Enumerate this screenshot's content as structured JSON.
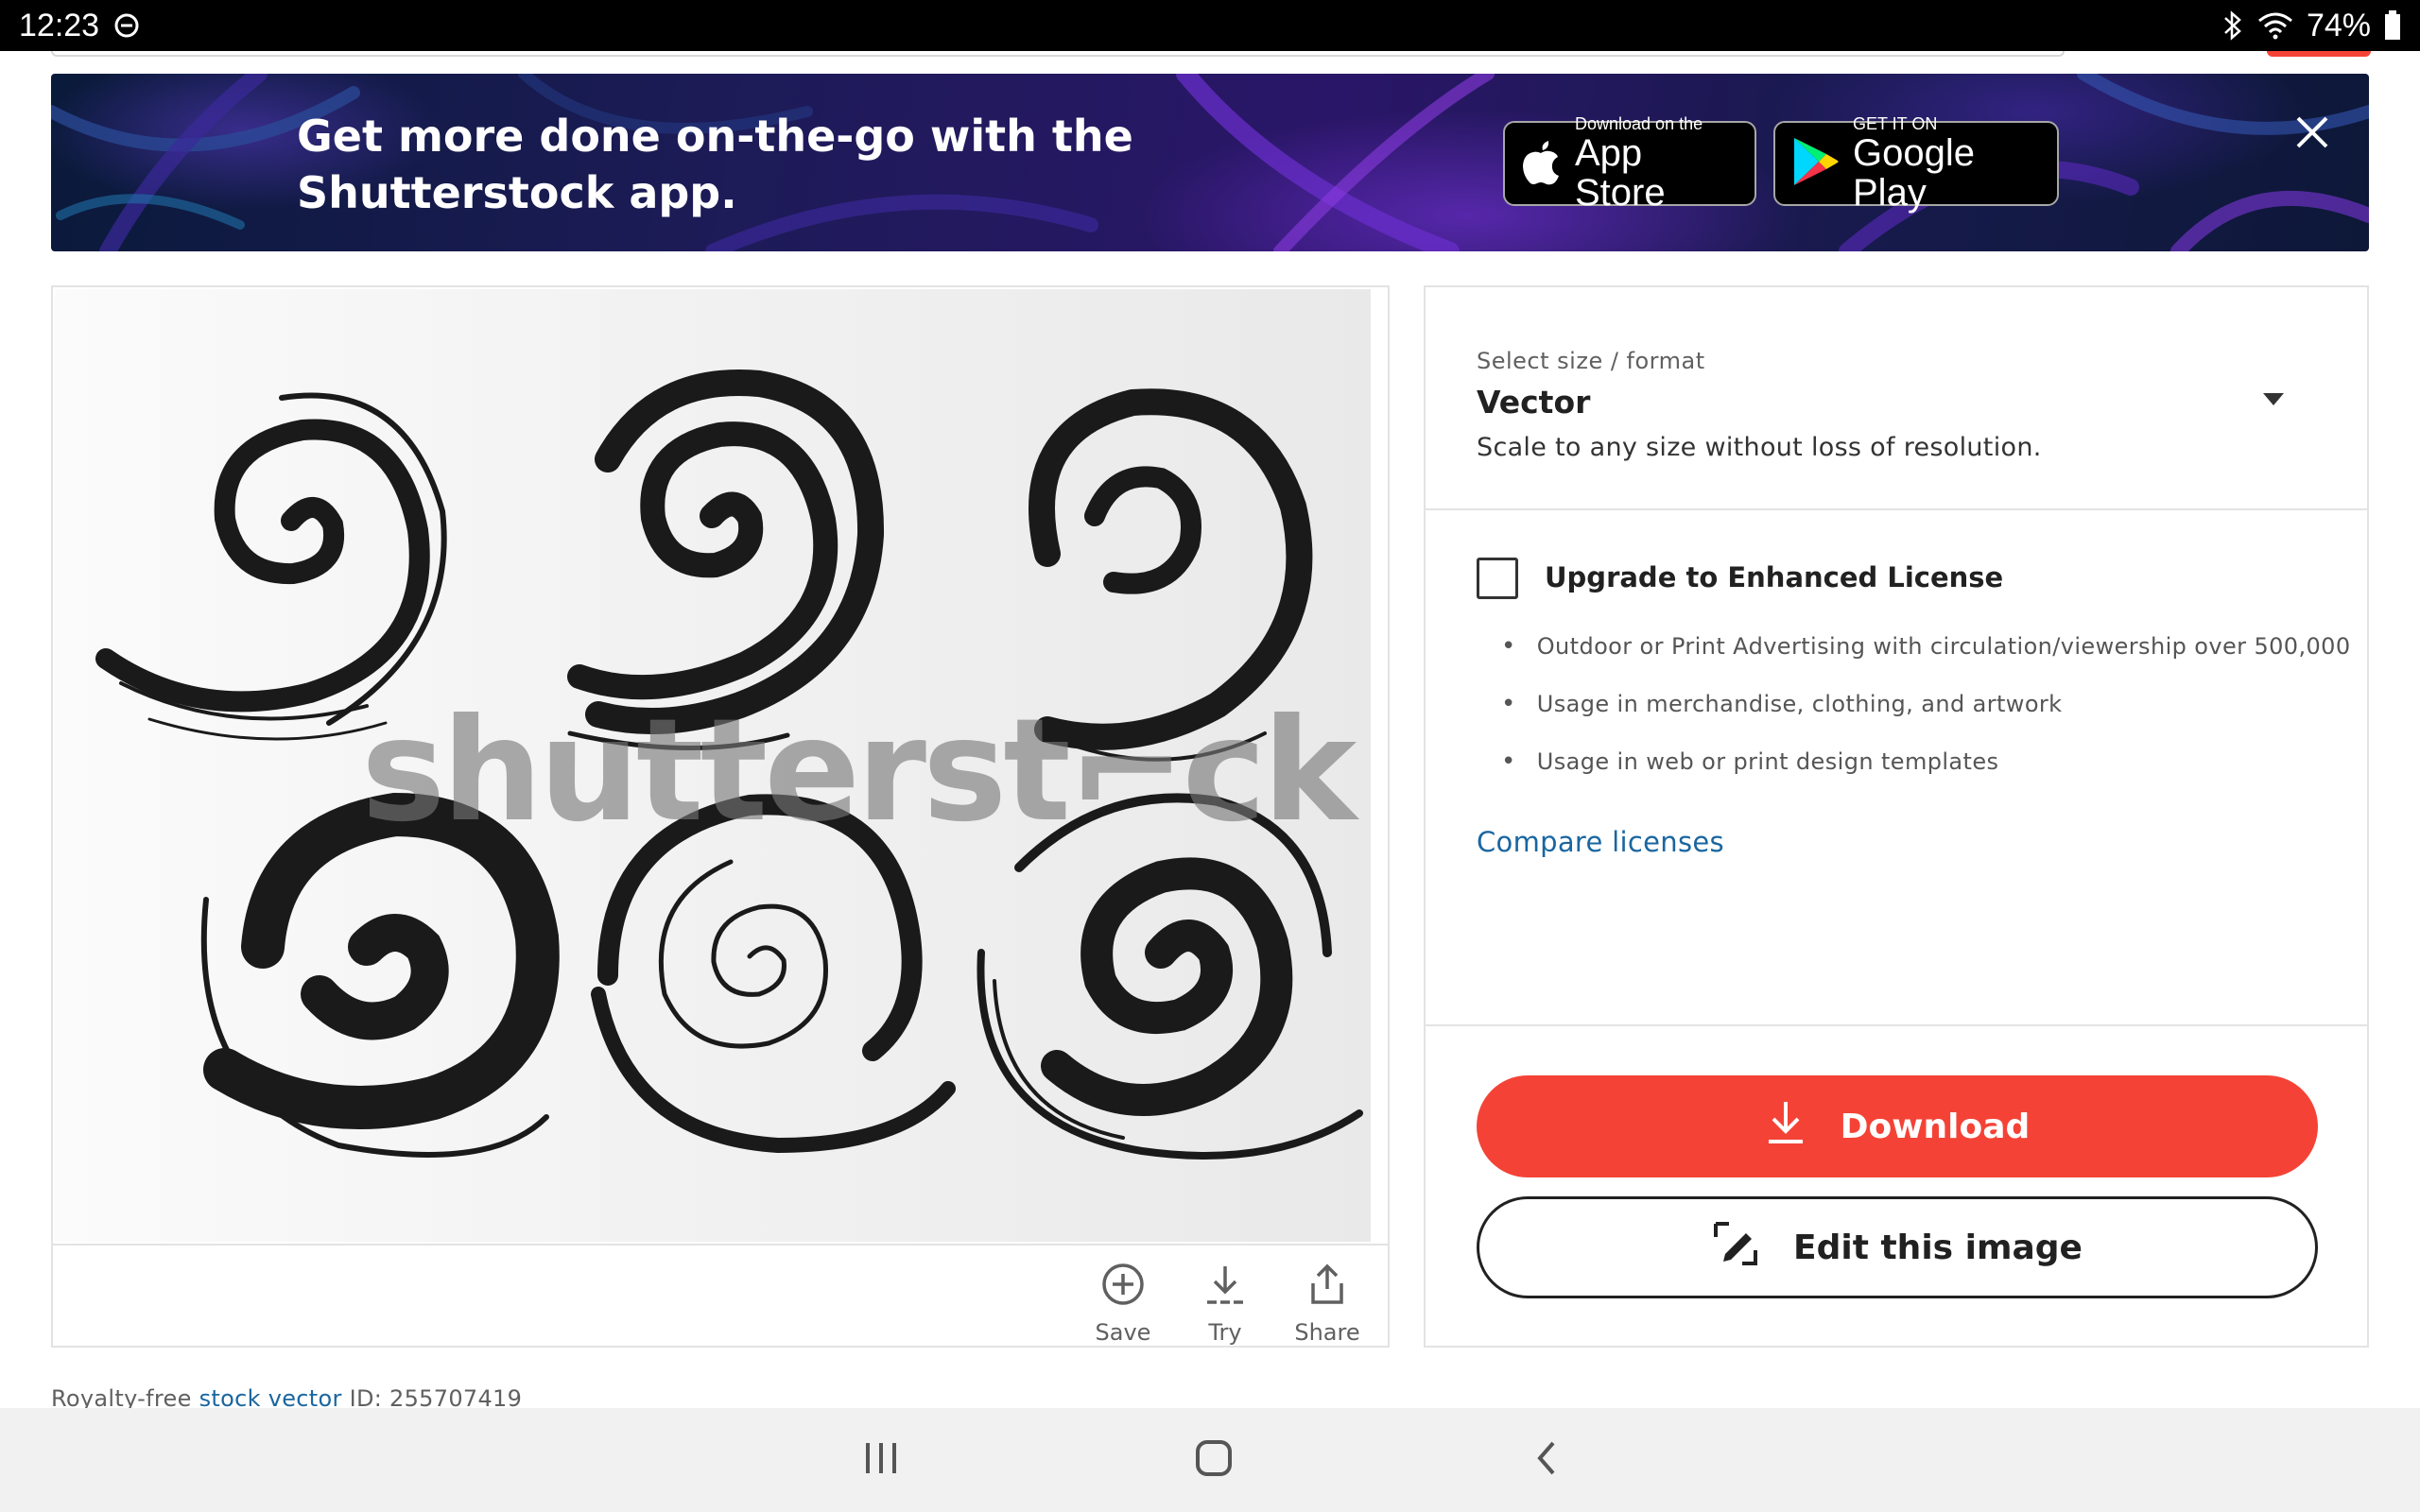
{
  "status_bar": {
    "time": "12:23",
    "battery": "74%",
    "icons": [
      "do-not-disturb-icon",
      "bluetooth-icon",
      "wifi-icon",
      "battery-icon"
    ]
  },
  "banner": {
    "text": "Get more done on-the-go with the Shutterstock app.",
    "app_store": {
      "small": "Download on the",
      "big": "App Store"
    },
    "google_play": {
      "small": "GET IT ON",
      "big": "Google Play"
    },
    "close_icon": "close-icon"
  },
  "image": {
    "watermark": "shutterst⌐ck",
    "actions": [
      {
        "label": "Save",
        "icon": "plus-circle-icon"
      },
      {
        "label": "Try",
        "icon": "download-try-icon"
      },
      {
        "label": "Share",
        "icon": "share-icon"
      }
    ]
  },
  "size_format": {
    "label": "Select size / format",
    "value": "Vector",
    "description": "Scale to any size without loss of resolution."
  },
  "license": {
    "title": "Upgrade to Enhanced License",
    "checked": false,
    "items": [
      "Outdoor or Print Advertising with circulation/viewership over 500,000",
      "Usage in merchandise, clothing, and artwork",
      "Usage in web or print design templates"
    ],
    "compare_link": "Compare licenses"
  },
  "buttons": {
    "download": "Download",
    "edit": "Edit this image"
  },
  "royalty": {
    "prefix": "Royalty-free",
    "link": "stock vector",
    "id_text": "ID: 255707419"
  },
  "colors": {
    "accent": "#f44336",
    "link": "#1a66a0"
  }
}
